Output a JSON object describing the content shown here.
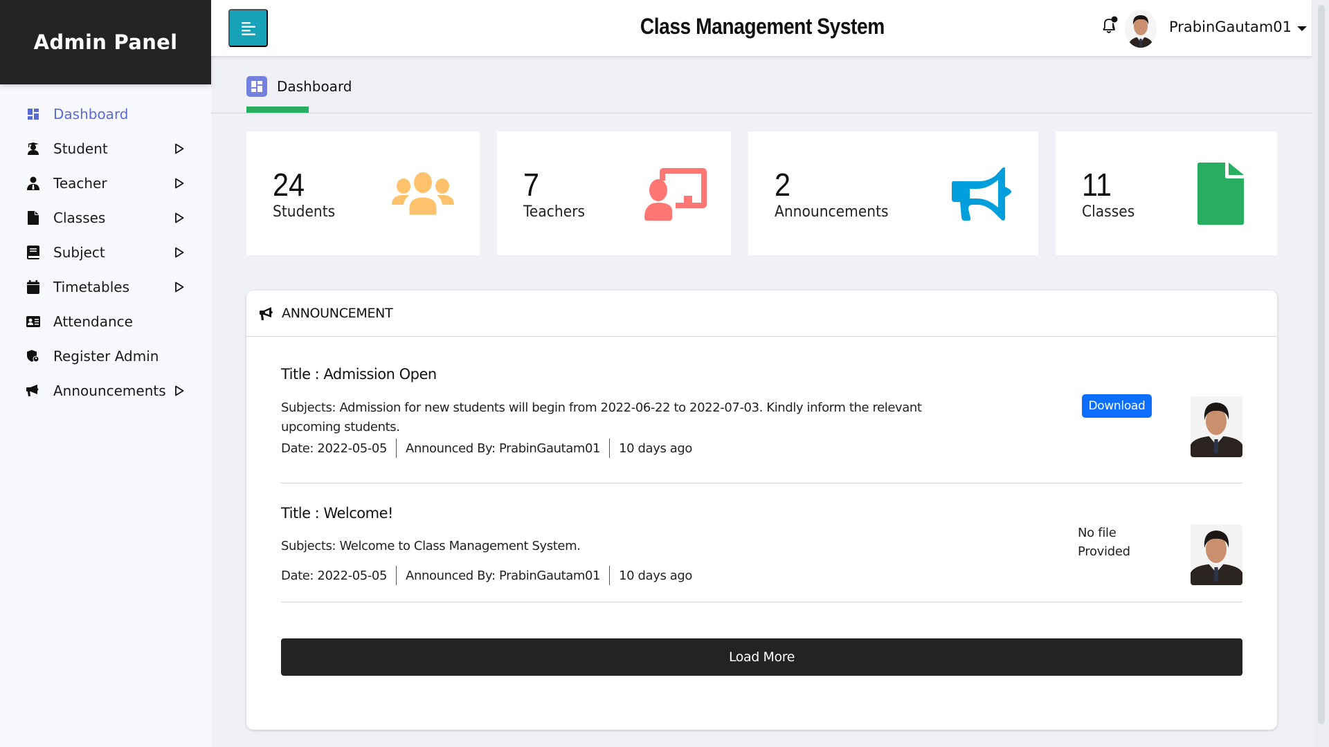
{
  "sidebar": {
    "title": "Admin Panel",
    "items": [
      {
        "label": "Dashboard",
        "icon": "dashboard-icon",
        "active": true,
        "has_submenu": false
      },
      {
        "label": "Student",
        "icon": "graduate-icon",
        "active": false,
        "has_submenu": true
      },
      {
        "label": "Teacher",
        "icon": "user-tie-icon",
        "active": false,
        "has_submenu": true
      },
      {
        "label": "Classes",
        "icon": "file-icon",
        "active": false,
        "has_submenu": true
      },
      {
        "label": "Subject",
        "icon": "book-icon",
        "active": false,
        "has_submenu": true
      },
      {
        "label": "Timetables",
        "icon": "calendar-icon",
        "active": false,
        "has_submenu": true
      },
      {
        "label": "Attendance",
        "icon": "id-card-icon",
        "active": false,
        "has_submenu": false
      },
      {
        "label": "Register Admin",
        "icon": "user-shield-icon",
        "active": false,
        "has_submenu": false
      },
      {
        "label": "Announcements",
        "icon": "bullhorn-icon",
        "active": false,
        "has_submenu": true
      }
    ]
  },
  "topbar": {
    "menu_icon": "align-left-icon",
    "title": "Class Management System",
    "notification_icon": "bell-icon",
    "username": "PrabinGautam01"
  },
  "breadcrumb": {
    "label": "Dashboard"
  },
  "stats": [
    {
      "value": "24",
      "label": "Students",
      "icon": "users-icon",
      "color": "#fec26d"
    },
    {
      "value": "7",
      "label": "Teachers",
      "icon": "chalkboard-teacher-icon",
      "color": "#ff7675"
    },
    {
      "value": "2",
      "label": "Announcements",
      "icon": "bullhorn-icon",
      "color": "#029fdc"
    },
    {
      "value": "11",
      "label": "Classes",
      "icon": "file-icon",
      "color": "#27ae60"
    }
  ],
  "announcements": {
    "header": "ANNOUNCEMENT",
    "items": [
      {
        "title": "Title : Admission Open",
        "body": "Subjects: Admission for new students will begin from 2022-06-22 to 2022-07-03. Kindly inform the relevant upcoming students.",
        "date": "Date: 2022-05-05",
        "announced_by": "Announced By: PrabinGautam01",
        "ago": "10 days ago",
        "file_action": "Download"
      },
      {
        "title": "Title : Welcome!",
        "body": "Subjects: Welcome to Class Management System.",
        "date": "Date: 2022-05-05",
        "announced_by": "Announced By: PrabinGautam01",
        "ago": "10 days ago",
        "file_note": "No file Provided"
      }
    ],
    "load_more": "Load More"
  },
  "colors": {
    "sidebar_header": "#232323",
    "accent_active": "#5b6bd6",
    "menu_button": "#18a2b8",
    "breadcrumb_underline": "#27ae60",
    "download_button": "#0d6efd",
    "load_more_button": "#232323"
  }
}
